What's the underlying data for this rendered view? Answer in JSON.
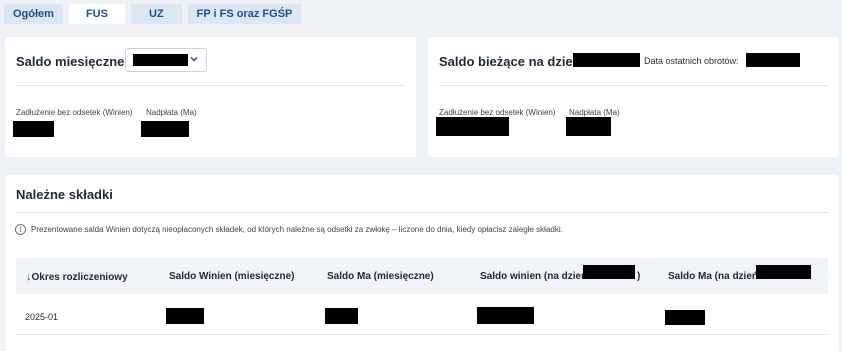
{
  "tabs": [
    {
      "label": "Ogółem",
      "active": false
    },
    {
      "label": "FUS",
      "active": true
    },
    {
      "label": "UZ",
      "active": false
    },
    {
      "label": "FP i FS oraz FGŚP",
      "active": false
    }
  ],
  "monthly_balance": {
    "title": "Saldo miesięczne:",
    "debt_label": "Zadłużenie bez odsetek (Winien)",
    "overpayment_label": "Nadpłata (Ma)"
  },
  "current_balance": {
    "title": "Saldo bieżące na dzień:",
    "last_turnover_label": "Data ostatnich obrotów:",
    "debt_label": "Zadłużenie bez odsetek (Winien)",
    "overpayment_label": "Nadpłata (Ma)"
  },
  "due_contributions": {
    "title": "Należne składki",
    "info_text": "Prezentowane salda Winien dotyczą nieopłaconych składek, od których należne są odsetki za zwłokę – liczone do dnia, kiedy opłacisz zaległe składki.",
    "columns": [
      "Okres rozliczeniowy",
      "Saldo Winien (miesięczne)",
      "Saldo Ma (miesięczne)",
      "Saldo winien (na dzień",
      ")",
      "Saldo Ma (na dzień"
    ],
    "rows": [
      {
        "period": "2025-01"
      }
    ]
  },
  "colors": {
    "accent": "#1e4f95",
    "tab_bg": "#dde6f3",
    "page_bg": "#eef1f5",
    "redaction": "#000000"
  },
  "icons": {
    "select_chevron": "chevron-down-icon",
    "info": "info-icon",
    "sort": "arrow-down-icon"
  }
}
